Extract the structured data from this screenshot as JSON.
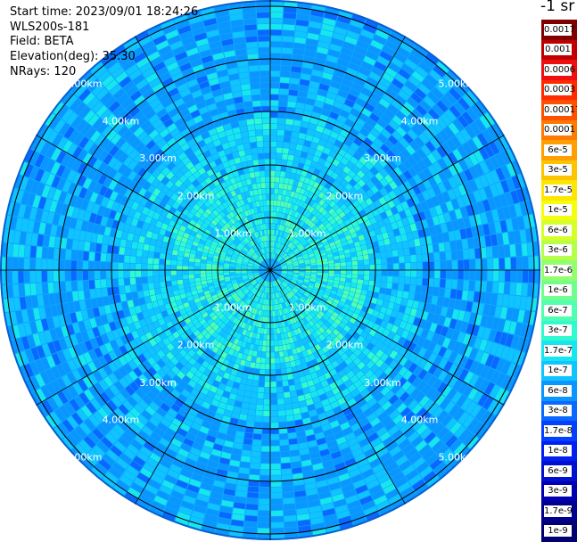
{
  "header": {
    "start_time": "Start time: 2023/09/01 18:24:26",
    "instrument": "WLS200s-181",
    "field": "Field: BETA",
    "elevation": "Elevation(deg): 35.30",
    "nrays": "NRays: 120"
  },
  "colorbar": {
    "title": "-1 sr",
    "ticks": [
      "0.0017",
      "0.001",
      "0.0006",
      "0.0003",
      "0.00017",
      "0.0001",
      "6e-5",
      "3e-5",
      "1.7e-5",
      "1e-5",
      "6e-6",
      "3e-6",
      "1.7e-6",
      "1e-6",
      "6e-7",
      "3e-7",
      "1.7e-7",
      "1e-7",
      "6e-8",
      "3e-8",
      "1.7e-8",
      "1e-8",
      "6e-9",
      "3e-9",
      "1.7e-9",
      "1e-9"
    ],
    "colors": [
      "#800000",
      "#c00000",
      "#ee1010",
      "#ff2a00",
      "#ff5000",
      "#ff7a00",
      "#ffa000",
      "#ffc400",
      "#ffe600",
      "#f4ff10",
      "#d6ff2a",
      "#b4ff4a",
      "#92ff6c",
      "#70ff8e",
      "#50ffb0",
      "#30fad0",
      "#18e6ee",
      "#10c4ff",
      "#0a96ff",
      "#0868ff",
      "#0440ff",
      "#0020f0",
      "#0010d0",
      "#0000b0",
      "#000090",
      "#000070"
    ]
  },
  "range_rings": {
    "labels": [
      "1.00km",
      "2.00km",
      "3.00km",
      "4.00km",
      "5.00km"
    ]
  },
  "map": {
    "rays": 120,
    "ring_colors": [
      "#00ffff",
      "#000000"
    ],
    "palette": [
      "#0a96ff",
      "#10c4ff",
      "#18e6ee",
      "#30fad0",
      "#50ffb0",
      "#70ff8e",
      "#0868ff"
    ]
  }
}
